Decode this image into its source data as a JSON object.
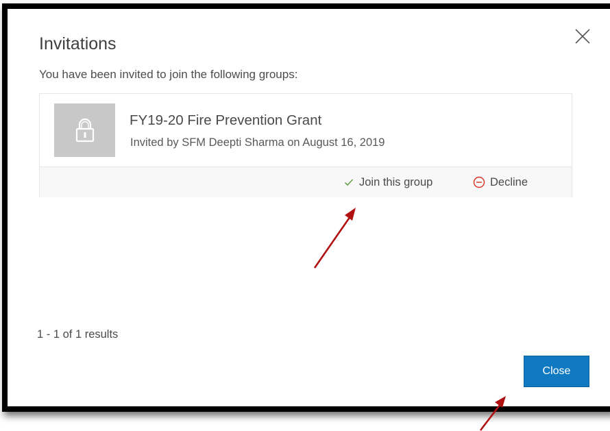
{
  "dialog": {
    "title": "Invitations",
    "subtitle": "You have been invited to join the following groups:",
    "close_icon": "close-icon"
  },
  "invitation": {
    "group_name": "FY19-20 Fire Prevention Grant",
    "invited_by": "Invited by SFM Deepti Sharma on August 16, 2019",
    "thumbnail_icon": "lock-icon",
    "join_label": "Join this group",
    "join_icon": "checkmark-icon",
    "decline_label": "Decline",
    "decline_icon": "minus-circle-icon"
  },
  "footer": {
    "results": "1 - 1 of 1 results",
    "close_label": "Close"
  },
  "colors": {
    "primary_button": "#0f79c2",
    "accept_check": "#5a9e3f",
    "decline_red": "#d83020",
    "annotation_arrow": "#b01010"
  }
}
